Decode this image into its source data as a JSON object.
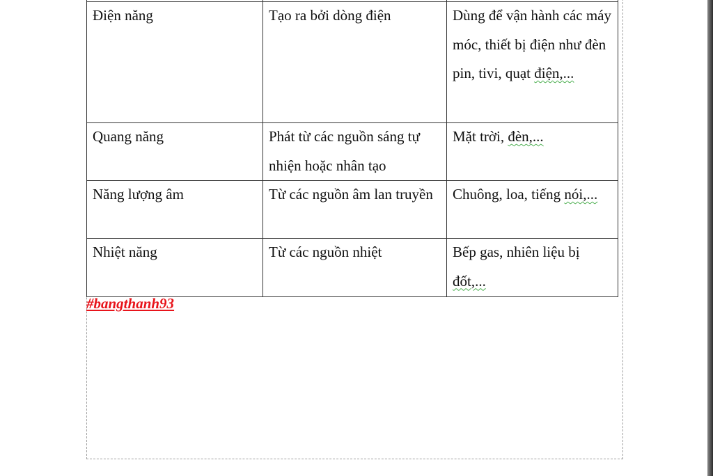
{
  "table": {
    "rows": [
      {
        "name": "Điện năng",
        "source": "Tạo ra bởi dòng điện",
        "usage_main": "Dùng để vận hành các máy móc, thiết bị điện như đèn pin, tivi, quạt ",
        "usage_tail": "điện,..."
      },
      {
        "name": "Quang năng",
        "source": "Phát từ các nguồn sáng tự nhiện hoặc nhân tạo",
        "usage_main": "Mặt trời, ",
        "usage_tail": "đèn,..."
      },
      {
        "name": "Năng lượng âm",
        "source": "Từ các nguồn âm lan truyền",
        "usage_main": "Chuông, loa, tiếng ",
        "usage_tail": "nói,..."
      },
      {
        "name": "Nhiệt năng",
        "source": "Từ các nguồn nhiệt",
        "usage_main": "Bếp gas, nhiên liệu bị ",
        "usage_tail": "đốt,..."
      }
    ]
  },
  "hashtag": "#bangthanh93",
  "colors": {
    "hashtag": "#e8141b",
    "spell_squiggle": "#4caf50"
  }
}
